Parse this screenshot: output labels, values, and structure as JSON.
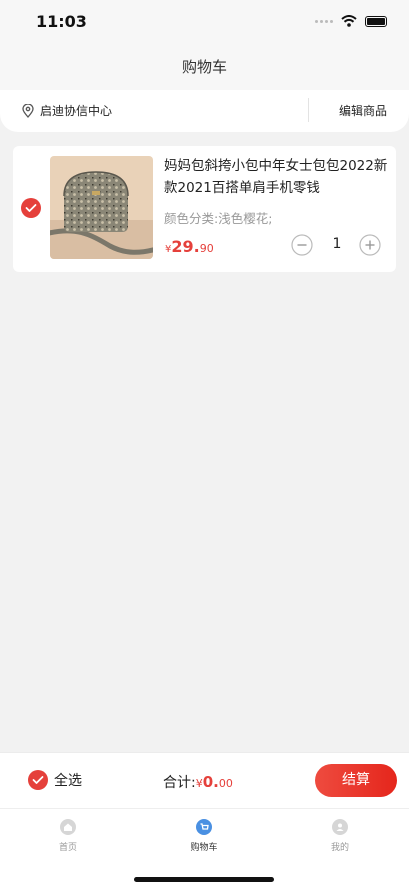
{
  "status_bar": {
    "time": "11:03"
  },
  "nav": {
    "title": "购物车"
  },
  "address_bar": {
    "address": "启迪协信中心",
    "edit_label": "编辑商品"
  },
  "cart": {
    "items": [
      {
        "title": "妈妈包斜挎小包中年女士包包2022新款2021百搭单肩手机零钱",
        "spec": "颜色分类:浅色樱花;",
        "price_currency": "¥",
        "price_int": "29.",
        "price_dec": "90",
        "quantity": "1",
        "checked": true
      }
    ]
  },
  "bottom_bar": {
    "select_all_label": "全选",
    "total_label": "合计:",
    "total_currency": "¥",
    "total_int": "0.",
    "total_dec": "00",
    "checkout_label": "结算"
  },
  "tabs": [
    {
      "label": "首页",
      "icon": "home-icon",
      "active": false
    },
    {
      "label": "购物车",
      "icon": "cart-icon",
      "active": true
    },
    {
      "label": "我的",
      "icon": "profile-icon",
      "active": false
    }
  ],
  "colors": {
    "accent": "#e5403b",
    "tab_active": "#4a90e2"
  }
}
